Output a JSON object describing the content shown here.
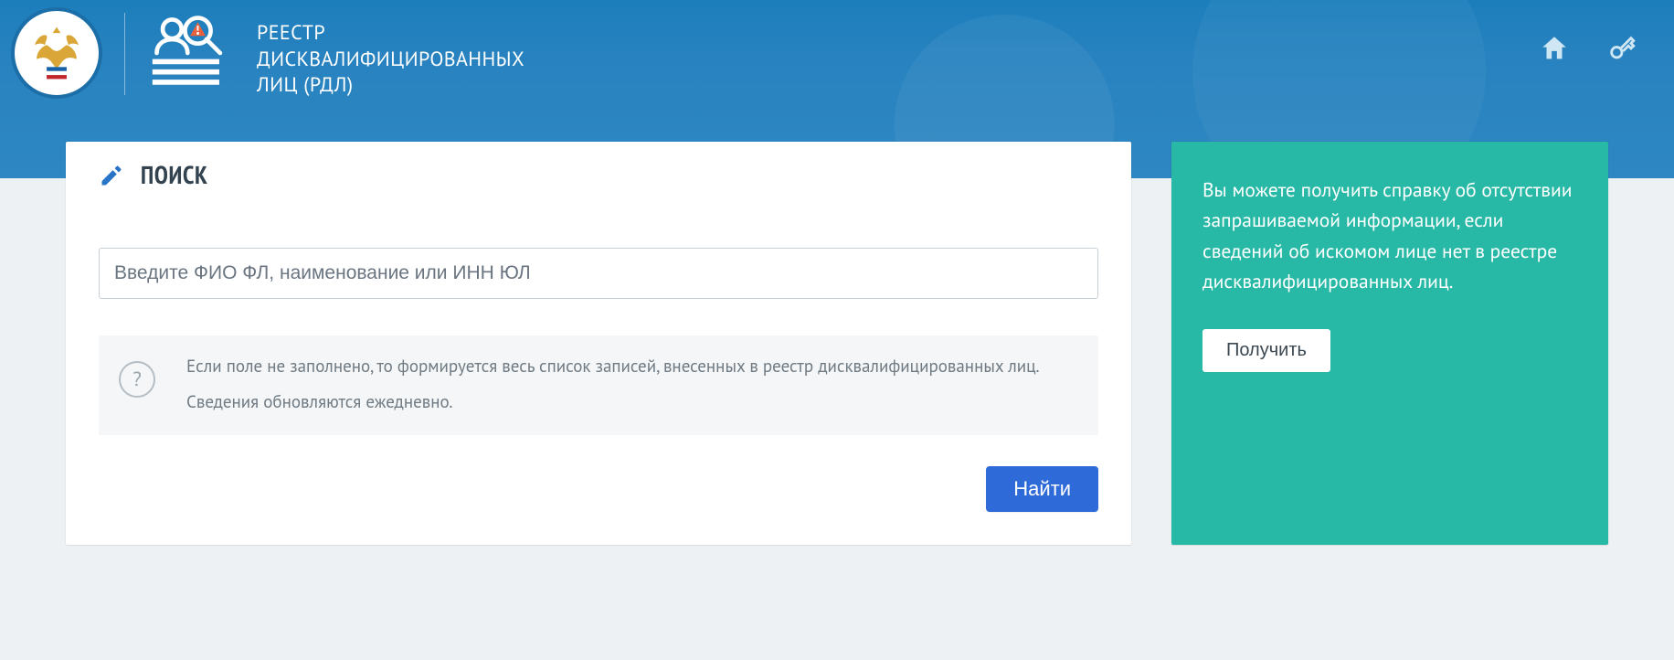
{
  "header": {
    "title_line1": "РЕЕСТР",
    "title_line2": "ДИСКВАЛИФИЦИРОВАННЫХ",
    "title_line3": "ЛИЦ (РДЛ)"
  },
  "search": {
    "heading": "ПОИСК",
    "placeholder": "Введите ФИО ФЛ, наименование или ИНН ЮЛ",
    "hint_line1": "Если поле не заполнено, то формируется весь список записей, внесенных в реестр дисквалифицированных лиц.",
    "hint_line2": "Сведения обновляются ежедневно.",
    "submit_label": "Найти"
  },
  "info": {
    "text": "Вы можете получить справку об отсутствии запрашиваемой информации, если сведений об искомом лице нет в реестре дисквалифицированных лиц.",
    "button_label": "Получить"
  }
}
